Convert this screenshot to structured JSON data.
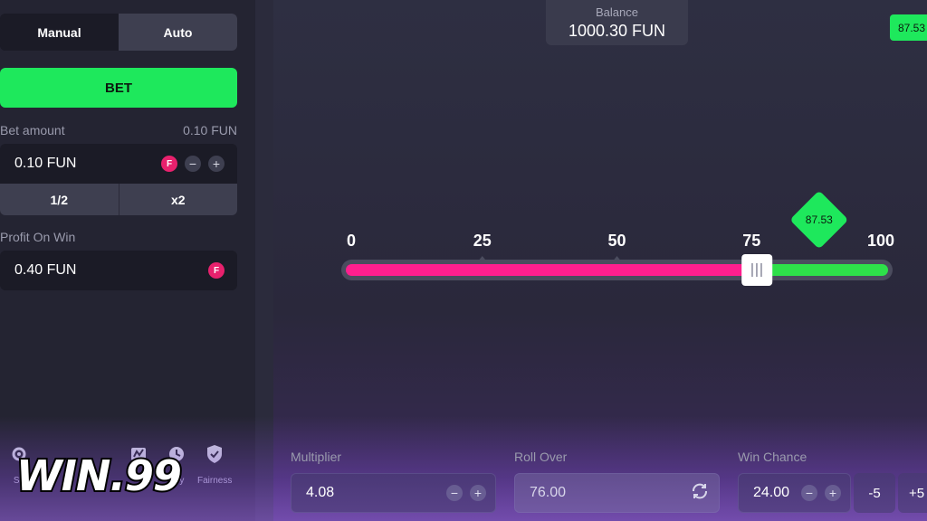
{
  "modes": {
    "manual": "Manual",
    "auto": "Auto"
  },
  "bet_button": "BET",
  "bet_amount": {
    "label": "Bet amount",
    "right_value": "0.10 FUN",
    "value": "0.10 FUN",
    "minus": "−",
    "plus": "+",
    "half": "1/2",
    "double": "x2"
  },
  "profit": {
    "label": "Profit On Win",
    "value": "0.40 FUN"
  },
  "bottom_nav": [
    {
      "label": "Se",
      "icon": "settings-icon"
    },
    {
      "label": "tory",
      "icon": "history-icon"
    },
    {
      "label": "Fairness",
      "icon": "shield-check-icon"
    }
  ],
  "watermark": "WIN.99",
  "balance": {
    "label": "Balance",
    "value": "1000.30 FUN"
  },
  "last_result": "87.53",
  "slider": {
    "ticks": [
      "0",
      "25",
      "50",
      "75",
      "100"
    ],
    "roll_over": 76.0,
    "result": 87.53,
    "result_label": "87.53",
    "lose_color": "#ff1f8e",
    "win_color": "#2ee04a"
  },
  "controls": {
    "multiplier": {
      "label": "Multiplier",
      "value": "4.08"
    },
    "roll_over": {
      "label": "Roll Over",
      "value": "76.00"
    },
    "win_chance": {
      "label": "Win Chance",
      "value": "24.00",
      "step_minus": "-5",
      "step_plus": "+5"
    }
  },
  "colors": {
    "accent_green": "#1ee85c",
    "coin_pink": "#e8216d"
  }
}
